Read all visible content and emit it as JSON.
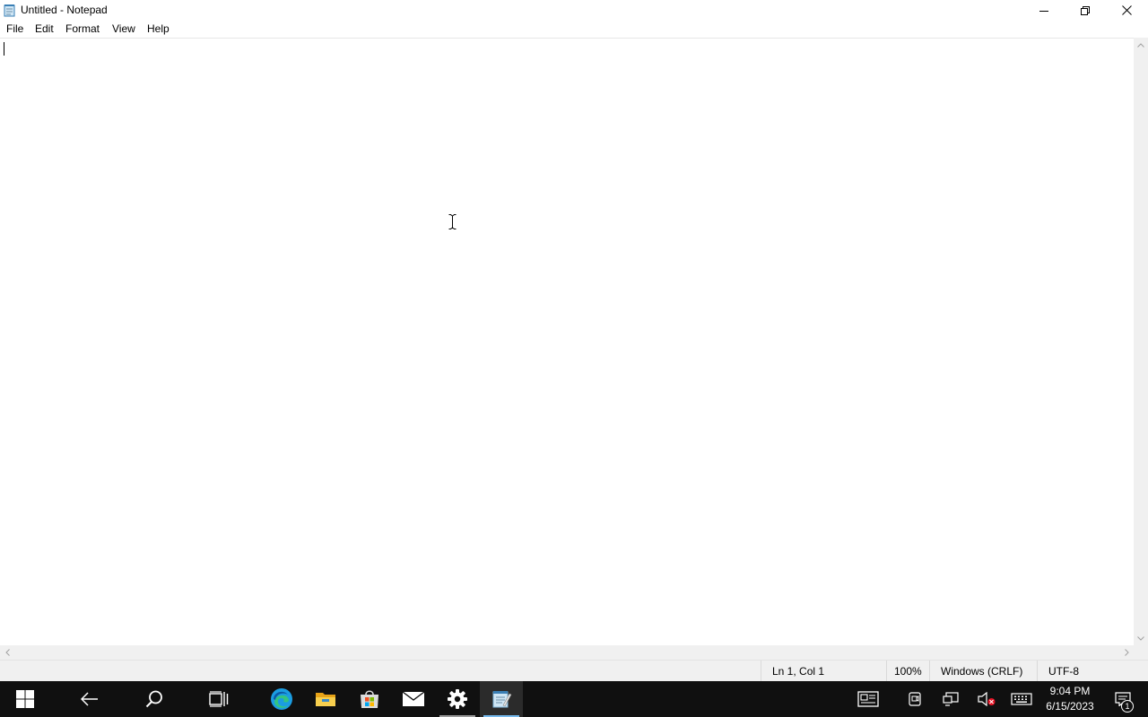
{
  "window": {
    "title": "Untitled - Notepad"
  },
  "menu": {
    "items": [
      "File",
      "Edit",
      "Format",
      "View",
      "Help"
    ]
  },
  "editor": {
    "content": ""
  },
  "status": {
    "position": "Ln 1, Col 1",
    "zoom": "100%",
    "line_endings": "Windows (CRLF)",
    "encoding": "UTF-8"
  },
  "taskbar": {
    "apps": [
      "start-icon",
      "back-icon",
      "search-icon",
      "task-view-icon",
      "edge-icon",
      "file-explorer-icon",
      "store-icon",
      "mail-icon",
      "settings-icon",
      "notepad-icon"
    ],
    "active_app": "notepad",
    "tray": [
      "news-icon",
      "meet-now-icon",
      "network-icon",
      "volume-muted-icon",
      "touch-keyboard-icon"
    ],
    "clock_time": "9:04 PM",
    "clock_date": "6/15/2023",
    "notification_count": "1",
    "accent_color": "#76b9ed"
  }
}
